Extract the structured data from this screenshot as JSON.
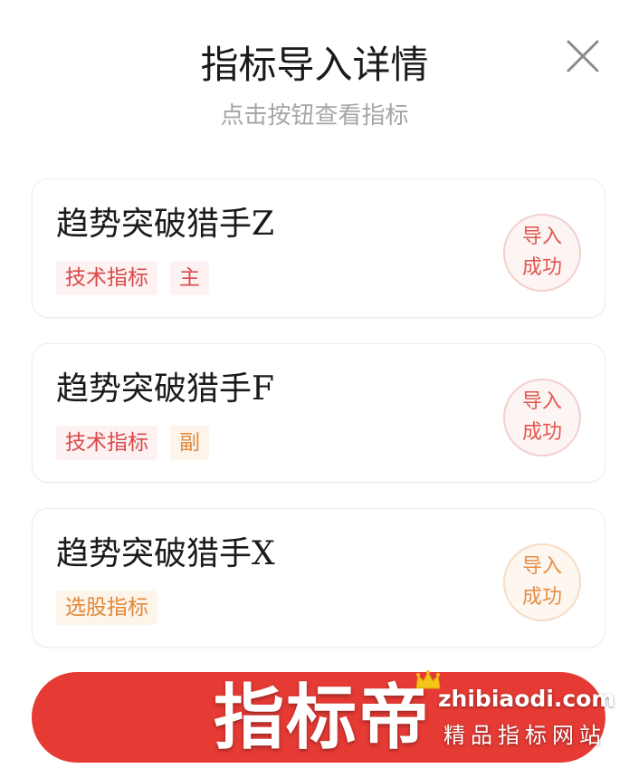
{
  "header": {
    "title": "指标导入详情",
    "subtitle": "点击按钮查看指标"
  },
  "colors": {
    "accent_red": "#e63a34",
    "tag_red": "#d94a4a",
    "tag_orange": "#e0883a",
    "badge_red": "#e0574f",
    "badge_orange": "#e48e46"
  },
  "cards": [
    {
      "name": "趋势突破猎手Z",
      "tags": [
        {
          "label": "技术指标",
          "tone": "red"
        },
        {
          "label": "主",
          "tone": "red"
        }
      ],
      "status": {
        "line1": "导入",
        "line2": "成功",
        "tone": "red"
      }
    },
    {
      "name": "趋势突破猎手F",
      "tags": [
        {
          "label": "技术指标",
          "tone": "red"
        },
        {
          "label": "副",
          "tone": "orange"
        }
      ],
      "status": {
        "line1": "导入",
        "line2": "成功",
        "tone": "red"
      }
    },
    {
      "name": "趋势突破猎手X",
      "tags": [
        {
          "label": "选股指标",
          "tone": "orange"
        }
      ],
      "status": {
        "line1": "导入",
        "line2": "成功",
        "tone": "orange"
      }
    }
  ],
  "watermark": {
    "logo_text": "指标帝",
    "url": "zhibiaodi.com",
    "slogan": "精品指标网站"
  },
  "icons": {
    "close": "close-icon",
    "crown": "crown-icon"
  }
}
